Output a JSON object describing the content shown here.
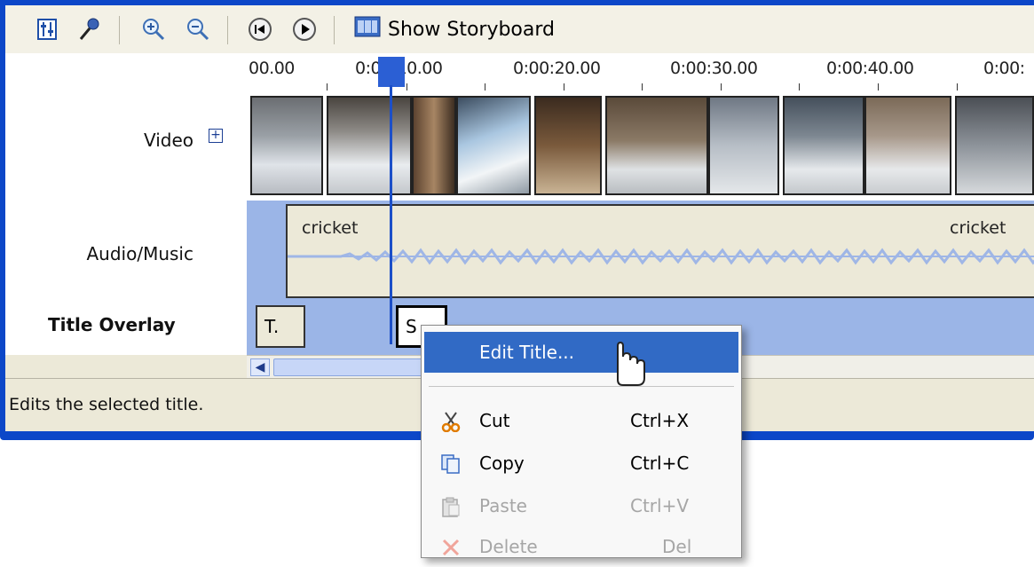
{
  "toolbar": {
    "buttons": [
      {
        "icon": "set-audio-levels-icon"
      },
      {
        "icon": "narrate-timeline-icon"
      },
      {
        "icon": "zoom-in-icon"
      },
      {
        "icon": "zoom-out-icon"
      },
      {
        "icon": "rewind-timeline-icon"
      },
      {
        "icon": "play-timeline-icon"
      }
    ],
    "show_storyboard_label": "Show Storyboard"
  },
  "timeline": {
    "ruler_labels": [
      "00.00",
      "0:00:10.00",
      "0:00:20.00",
      "0:00:30.00",
      "0:00:40.00",
      "0:00:"
    ],
    "tracks": {
      "video_label": "Video",
      "video_expand": "+",
      "audio_label": "Audio/Music",
      "title_overlay_label": "Title Overlay"
    },
    "audio_clips": [
      "cricket",
      "cricket"
    ],
    "title_clips": [
      "T.",
      "S"
    ]
  },
  "status_bar": {
    "text": "Edits the selected title."
  },
  "context_menu": {
    "items": [
      {
        "label": "Edit Title...",
        "shortcut": "",
        "icon": "",
        "state": "selected"
      },
      {
        "label": "Cut",
        "shortcut": "Ctrl+X",
        "icon": "scissors-icon",
        "state": "enabled"
      },
      {
        "label": "Copy",
        "shortcut": "Ctrl+C",
        "icon": "copy-icon",
        "state": "enabled"
      },
      {
        "label": "Paste",
        "shortcut": "Ctrl+V",
        "icon": "paste-icon",
        "state": "disabled"
      },
      {
        "label": "Delete",
        "shortcut": "Del",
        "icon": "delete-icon",
        "state": "disabled"
      }
    ]
  },
  "colors": {
    "window_frame": "#0c47c8",
    "menu_selection": "#316ac5",
    "timeline_background": "#9bb5e7",
    "playhead": "#1c4fc8"
  }
}
